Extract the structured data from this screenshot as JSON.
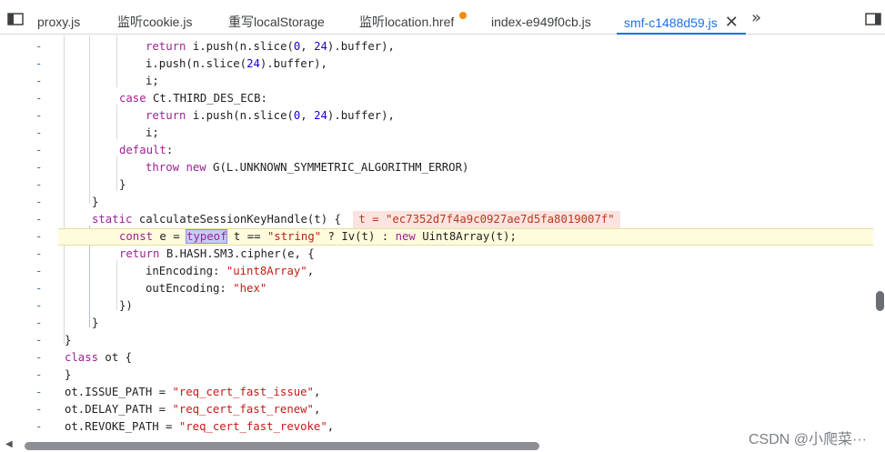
{
  "tabs": [
    {
      "label": "proxy.js"
    },
    {
      "label": "监听cookie.js"
    },
    {
      "label": "重写localStorage"
    },
    {
      "label": "监听location.href"
    },
    {
      "label": "index-e949f0cb.js"
    },
    {
      "label": "smf-c1488d59.js",
      "active": true
    }
  ],
  "more_label": "»",
  "close_glyph": "✕",
  "lines": [
    {
      "gutter": "-",
      "text": "        return i.push(n.slice(0, 24).buffer),"
    },
    {
      "gutter": "-",
      "text": "        i.push(n.slice(24).buffer),"
    },
    {
      "gutter": "-",
      "text": "        i;"
    },
    {
      "gutter": "-",
      "text": "    case Ct.THIRD_DES_ECB:"
    },
    {
      "gutter": "-",
      "text": "        return i.push(n.slice(0, 24).buffer),"
    },
    {
      "gutter": "-",
      "text": "        i;"
    },
    {
      "gutter": "-",
      "text": "    default:"
    },
    {
      "gutter": "-",
      "text": "        throw new G(L.UNKNOWN_SYMMETRIC_ALGORITHM_ERROR)"
    },
    {
      "gutter": "-",
      "text": "        }"
    },
    {
      "gutter": "-",
      "text": "    }"
    },
    {
      "gutter": "-",
      "text": "    static calculateSessionKeyHandle(t) {"
    },
    {
      "gutter": "-",
      "text": "        const e = typeof t == \"string\" ? Iv(t) : new Uint8Array(t);"
    },
    {
      "gutter": "-",
      "text": "        return B.HASH.SM3.cipher(e, {"
    },
    {
      "gutter": "-",
      "text": "            inEncoding: \"uint8Array\","
    },
    {
      "gutter": "-",
      "text": "            outEncoding: \"hex\""
    },
    {
      "gutter": "-",
      "text": "        })"
    },
    {
      "gutter": "-",
      "text": "    }"
    },
    {
      "gutter": "-",
      "text": "}"
    },
    {
      "gutter": "-",
      "text": "class ot {"
    },
    {
      "gutter": "-",
      "text": "}"
    },
    {
      "gutter": "-",
      "text": "ot.ISSUE_PATH = \"req_cert_fast_issue\","
    },
    {
      "gutter": "-",
      "text": "ot.DELAY_PATH = \"req_cert_fast_renew\","
    },
    {
      "gutter": "-",
      "text": "ot.REVOKE_PATH = \"req_cert_fast_revoke\","
    }
  ],
  "inline_value": "t = \"ec7352d7f4a9c0927ae7d5fa8019007f\"",
  "watermark": "CSDN @小爬菜···",
  "colors": {
    "keyword": "#9b2393",
    "string": "#c41a16",
    "number": "#1c00cf",
    "active_tab": "#1a73e8",
    "highlight": "#fffbdd"
  }
}
